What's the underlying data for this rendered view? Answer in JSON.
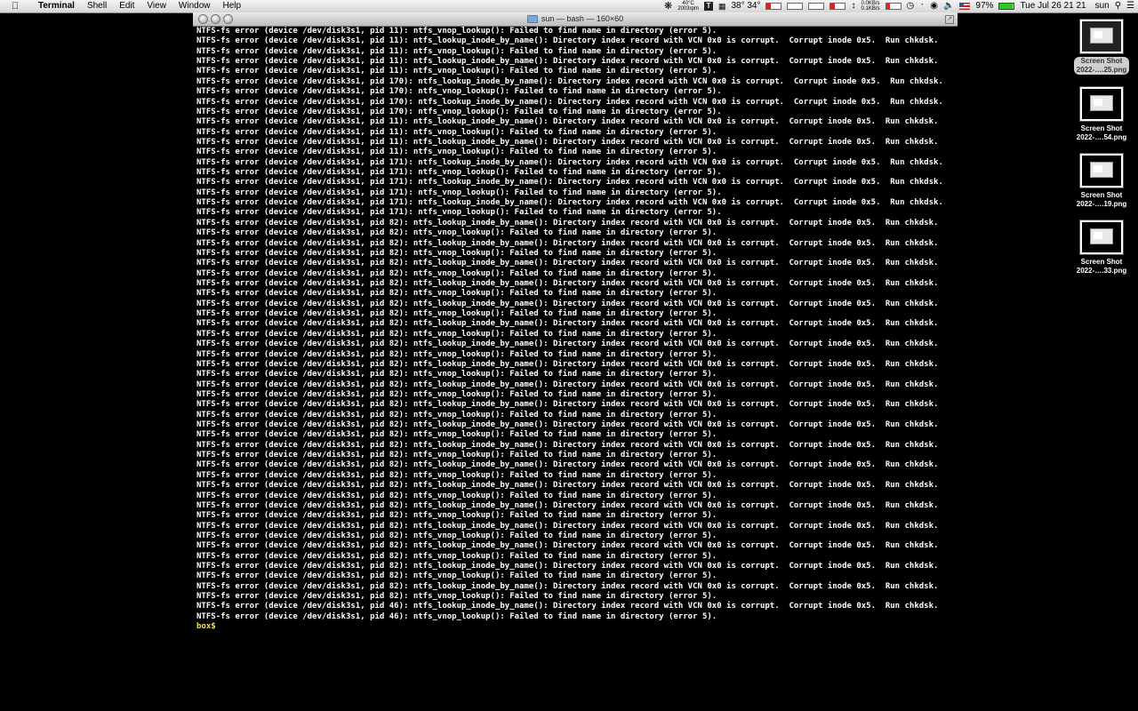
{
  "menubar": {
    "apple_icon": "apple-logo-icon",
    "items": [
      "Terminal",
      "Shell",
      "Edit",
      "View",
      "Window",
      "Help"
    ],
    "status": {
      "cpu_temp": "40°C",
      "fan_rpm": "2003rpm",
      "weather": "38° 34°",
      "net_up": "0.0KB/s",
      "net_down": "0.1KB/s",
      "battery": "97%",
      "datetime": "Tue Jul 26  21 21",
      "user": "sun"
    }
  },
  "window": {
    "title": "sun — bash — 160×60",
    "prompt": "box$"
  },
  "terminal_lines": [
    "NTFS-fs error (device /dev/disk3s1, pid 11): ntfs_vnop_lookup(): Failed to find name in directory (error 5).",
    "NTFS-fs error (device /dev/disk3s1, pid 11): ntfs_lookup_inode_by_name(): Directory index record with VCN 0x0 is corrupt.  Corrupt inode 0x5.  Run chkdsk.",
    "NTFS-fs error (device /dev/disk3s1, pid 11): ntfs_vnop_lookup(): Failed to find name in directory (error 5).",
    "NTFS-fs error (device /dev/disk3s1, pid 11): ntfs_lookup_inode_by_name(): Directory index record with VCN 0x0 is corrupt.  Corrupt inode 0x5.  Run chkdsk.",
    "NTFS-fs error (device /dev/disk3s1, pid 11): ntfs_vnop_lookup(): Failed to find name in directory (error 5).",
    "NTFS-fs error (device /dev/disk3s1, pid 170): ntfs_lookup_inode_by_name(): Directory index record with VCN 0x0 is corrupt.  Corrupt inode 0x5.  Run chkdsk.",
    "NTFS-fs error (device /dev/disk3s1, pid 170): ntfs_vnop_lookup(): Failed to find name in directory (error 5).",
    "NTFS-fs error (device /dev/disk3s1, pid 170): ntfs_lookup_inode_by_name(): Directory index record with VCN 0x0 is corrupt.  Corrupt inode 0x5.  Run chkdsk.",
    "NTFS-fs error (device /dev/disk3s1, pid 170): ntfs_vnop_lookup(): Failed to find name in directory (error 5).",
    "NTFS-fs error (device /dev/disk3s1, pid 11): ntfs_lookup_inode_by_name(): Directory index record with VCN 0x0 is corrupt.  Corrupt inode 0x5.  Run chkdsk.",
    "NTFS-fs error (device /dev/disk3s1, pid 11): ntfs_vnop_lookup(): Failed to find name in directory (error 5).",
    "NTFS-fs error (device /dev/disk3s1, pid 11): ntfs_lookup_inode_by_name(): Directory index record with VCN 0x0 is corrupt.  Corrupt inode 0x5.  Run chkdsk.",
    "NTFS-fs error (device /dev/disk3s1, pid 11): ntfs_vnop_lookup(): Failed to find name in directory (error 5).",
    "NTFS-fs error (device /dev/disk3s1, pid 171): ntfs_lookup_inode_by_name(): Directory index record with VCN 0x0 is corrupt.  Corrupt inode 0x5.  Run chkdsk.",
    "NTFS-fs error (device /dev/disk3s1, pid 171): ntfs_vnop_lookup(): Failed to find name in directory (error 5).",
    "NTFS-fs error (device /dev/disk3s1, pid 171): ntfs_lookup_inode_by_name(): Directory index record with VCN 0x0 is corrupt.  Corrupt inode 0x5.  Run chkdsk.",
    "NTFS-fs error (device /dev/disk3s1, pid 171): ntfs_vnop_lookup(): Failed to find name in directory (error 5).",
    "NTFS-fs error (device /dev/disk3s1, pid 171): ntfs_lookup_inode_by_name(): Directory index record with VCN 0x0 is corrupt.  Corrupt inode 0x5.  Run chkdsk.",
    "NTFS-fs error (device /dev/disk3s1, pid 171): ntfs_vnop_lookup(): Failed to find name in directory (error 5).",
    "NTFS-fs error (device /dev/disk3s1, pid 82): ntfs_lookup_inode_by_name(): Directory index record with VCN 0x0 is corrupt.  Corrupt inode 0x5.  Run chkdsk.",
    "NTFS-fs error (device /dev/disk3s1, pid 82): ntfs_vnop_lookup(): Failed to find name in directory (error 5).",
    "NTFS-fs error (device /dev/disk3s1, pid 82): ntfs_lookup_inode_by_name(): Directory index record with VCN 0x0 is corrupt.  Corrupt inode 0x5.  Run chkdsk.",
    "NTFS-fs error (device /dev/disk3s1, pid 82): ntfs_vnop_lookup(): Failed to find name in directory (error 5).",
    "NTFS-fs error (device /dev/disk3s1, pid 82): ntfs_lookup_inode_by_name(): Directory index record with VCN 0x0 is corrupt.  Corrupt inode 0x5.  Run chkdsk.",
    "NTFS-fs error (device /dev/disk3s1, pid 82): ntfs_vnop_lookup(): Failed to find name in directory (error 5).",
    "NTFS-fs error (device /dev/disk3s1, pid 82): ntfs_lookup_inode_by_name(): Directory index record with VCN 0x0 is corrupt.  Corrupt inode 0x5.  Run chkdsk.",
    "NTFS-fs error (device /dev/disk3s1, pid 82): ntfs_vnop_lookup(): Failed to find name in directory (error 5).",
    "NTFS-fs error (device /dev/disk3s1, pid 82): ntfs_lookup_inode_by_name(): Directory index record with VCN 0x0 is corrupt.  Corrupt inode 0x5.  Run chkdsk.",
    "NTFS-fs error (device /dev/disk3s1, pid 82): ntfs_vnop_lookup(): Failed to find name in directory (error 5).",
    "NTFS-fs error (device /dev/disk3s1, pid 82): ntfs_lookup_inode_by_name(): Directory index record with VCN 0x0 is corrupt.  Corrupt inode 0x5.  Run chkdsk.",
    "NTFS-fs error (device /dev/disk3s1, pid 82): ntfs_vnop_lookup(): Failed to find name in directory (error 5).",
    "NTFS-fs error (device /dev/disk3s1, pid 82): ntfs_lookup_inode_by_name(): Directory index record with VCN 0x0 is corrupt.  Corrupt inode 0x5.  Run chkdsk.",
    "NTFS-fs error (device /dev/disk3s1, pid 82): ntfs_vnop_lookup(): Failed to find name in directory (error 5).",
    "NTFS-fs error (device /dev/disk3s1, pid 82): ntfs_lookup_inode_by_name(): Directory index record with VCN 0x0 is corrupt.  Corrupt inode 0x5.  Run chkdsk.",
    "NTFS-fs error (device /dev/disk3s1, pid 82): ntfs_vnop_lookup(): Failed to find name in directory (error 5).",
    "NTFS-fs error (device /dev/disk3s1, pid 82): ntfs_lookup_inode_by_name(): Directory index record with VCN 0x0 is corrupt.  Corrupt inode 0x5.  Run chkdsk.",
    "NTFS-fs error (device /dev/disk3s1, pid 82): ntfs_vnop_lookup(): Failed to find name in directory (error 5).",
    "NTFS-fs error (device /dev/disk3s1, pid 82): ntfs_lookup_inode_by_name(): Directory index record with VCN 0x0 is corrupt.  Corrupt inode 0x5.  Run chkdsk.",
    "NTFS-fs error (device /dev/disk3s1, pid 82): ntfs_vnop_lookup(): Failed to find name in directory (error 5).",
    "NTFS-fs error (device /dev/disk3s1, pid 82): ntfs_lookup_inode_by_name(): Directory index record with VCN 0x0 is corrupt.  Corrupt inode 0x5.  Run chkdsk.",
    "NTFS-fs error (device /dev/disk3s1, pid 82): ntfs_vnop_lookup(): Failed to find name in directory (error 5).",
    "NTFS-fs error (device /dev/disk3s1, pid 82): ntfs_lookup_inode_by_name(): Directory index record with VCN 0x0 is corrupt.  Corrupt inode 0x5.  Run chkdsk.",
    "NTFS-fs error (device /dev/disk3s1, pid 82): ntfs_vnop_lookup(): Failed to find name in directory (error 5).",
    "NTFS-fs error (device /dev/disk3s1, pid 82): ntfs_lookup_inode_by_name(): Directory index record with VCN 0x0 is corrupt.  Corrupt inode 0x5.  Run chkdsk.",
    "NTFS-fs error (device /dev/disk3s1, pid 82): ntfs_vnop_lookup(): Failed to find name in directory (error 5).",
    "NTFS-fs error (device /dev/disk3s1, pid 82): ntfs_lookup_inode_by_name(): Directory index record with VCN 0x0 is corrupt.  Corrupt inode 0x5.  Run chkdsk.",
    "NTFS-fs error (device /dev/disk3s1, pid 82): ntfs_vnop_lookup(): Failed to find name in directory (error 5).",
    "NTFS-fs error (device /dev/disk3s1, pid 82): ntfs_lookup_inode_by_name(): Directory index record with VCN 0x0 is corrupt.  Corrupt inode 0x5.  Run chkdsk.",
    "NTFS-fs error (device /dev/disk3s1, pid 82): ntfs_vnop_lookup(): Failed to find name in directory (error 5).",
    "NTFS-fs error (device /dev/disk3s1, pid 82): ntfs_lookup_inode_by_name(): Directory index record with VCN 0x0 is corrupt.  Corrupt inode 0x5.  Run chkdsk.",
    "NTFS-fs error (device /dev/disk3s1, pid 82): ntfs_vnop_lookup(): Failed to find name in directory (error 5).",
    "NTFS-fs error (device /dev/disk3s1, pid 82): ntfs_lookup_inode_by_name(): Directory index record with VCN 0x0 is corrupt.  Corrupt inode 0x5.  Run chkdsk.",
    "NTFS-fs error (device /dev/disk3s1, pid 82): ntfs_vnop_lookup(): Failed to find name in directory (error 5).",
    "NTFS-fs error (device /dev/disk3s1, pid 82): ntfs_lookup_inode_by_name(): Directory index record with VCN 0x0 is corrupt.  Corrupt inode 0x5.  Run chkdsk.",
    "NTFS-fs error (device /dev/disk3s1, pid 82): ntfs_vnop_lookup(): Failed to find name in directory (error 5).",
    "NTFS-fs error (device /dev/disk3s1, pid 82): ntfs_lookup_inode_by_name(): Directory index record with VCN 0x0 is corrupt.  Corrupt inode 0x5.  Run chkdsk.",
    "NTFS-fs error (device /dev/disk3s1, pid 82): ntfs_vnop_lookup(): Failed to find name in directory (error 5).",
    "NTFS-fs error (device /dev/disk3s1, pid 46): ntfs_lookup_inode_by_name(): Directory index record with VCN 0x0 is corrupt.  Corrupt inode 0x5.  Run chkdsk.",
    "NTFS-fs error (device /dev/disk3s1, pid 46): ntfs_vnop_lookup(): Failed to find name in directory (error 5)."
  ],
  "desktop_icons": [
    {
      "line1": "Screen Shot",
      "line2": "2022-….25.png",
      "selected": true
    },
    {
      "line1": "Screen Shot",
      "line2": "2022-….54.png",
      "selected": false
    },
    {
      "line1": "Screen Shot",
      "line2": "2022-….19.png",
      "selected": false
    },
    {
      "line1": "Screen Shot",
      "line2": "2022-….33.png",
      "selected": false
    }
  ]
}
